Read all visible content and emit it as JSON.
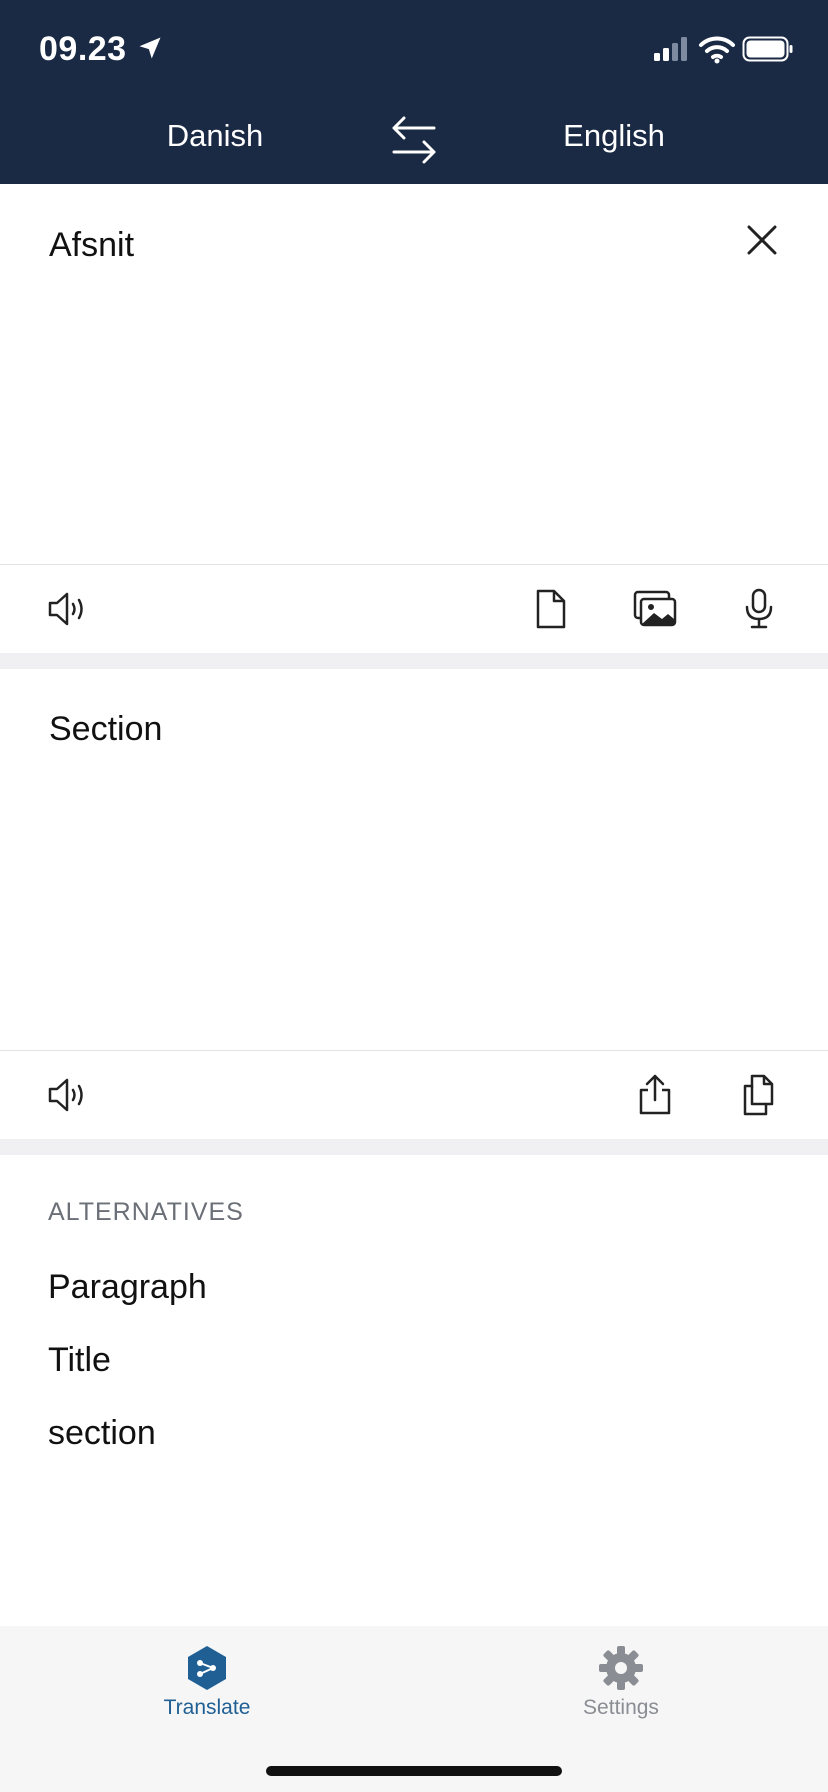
{
  "status_bar": {
    "time": "09.23"
  },
  "languages": {
    "source": "Danish",
    "target": "English"
  },
  "source": {
    "text": "Afsnit"
  },
  "target": {
    "text": "Section"
  },
  "alternatives": {
    "title": "ALTERNATIVES",
    "items": [
      "Paragraph",
      "Title",
      "section"
    ]
  },
  "tabs": [
    {
      "label": "Translate",
      "icon": "deepl-translate-icon",
      "active": true
    },
    {
      "label": "Settings",
      "icon": "gear-icon",
      "active": false
    }
  ],
  "colors": {
    "header_bg": "#1a2a44",
    "accent": "#1f5f94",
    "inactive": "#8a8d93"
  }
}
